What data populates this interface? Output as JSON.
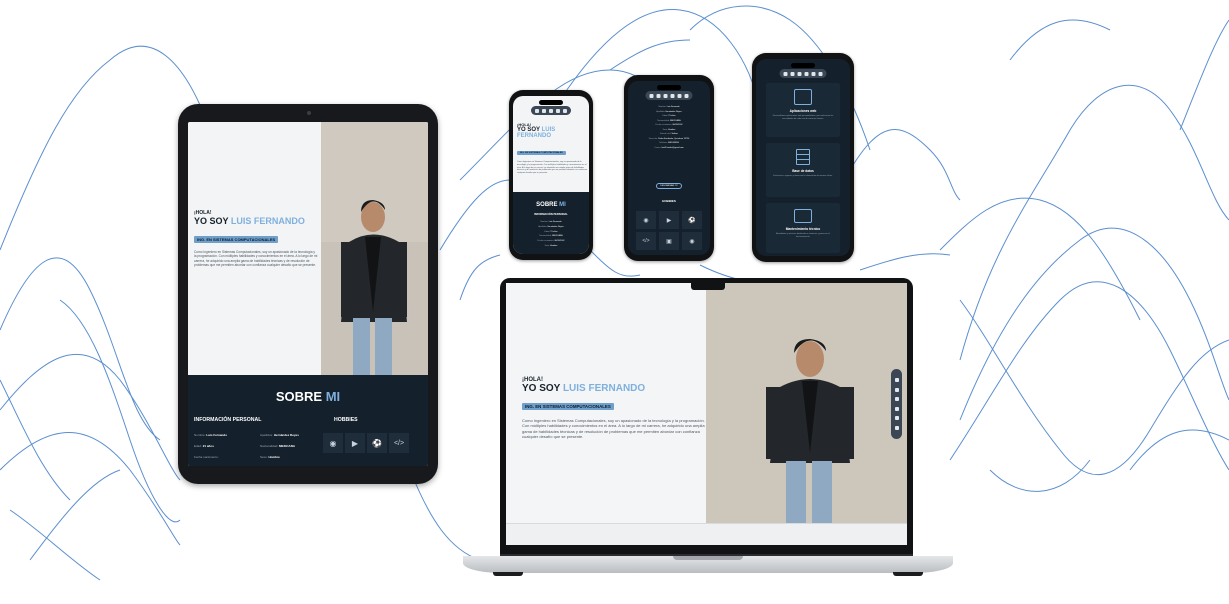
{
  "colors": {
    "navy": "#14202b",
    "accent": "#7fb0dd",
    "tag": "#6fa0cc",
    "wave": "#5b8fcf",
    "hero_bg": "#f2f4f5"
  },
  "hero": {
    "hola": "¡HOLA!",
    "yo_soy": "YO SOY",
    "name": "LUIS FERNANDO",
    "tag": "ING. EN SISTEMAS COMPUTACIONALES",
    "bio": "Como Ingeniero en Sistemas Computacionales, soy un apasionado de la tecnología y la programación. Con múltiples habilidades y conocimientos en el área. A lo largo de mi carrera, he adquirido una amplia gama de habilidades técnicas y de resolución de problemas que me permiten abordar con confianza cualquier desafío que se presente."
  },
  "about": {
    "title_a": "SOBRE",
    "title_b": "MI",
    "personal_heading": "INFORMACIÓN PERSONAL",
    "hobbies_heading": "HOBBIES",
    "fields": [
      {
        "label": "Nombre:",
        "value": "Luis Fernando"
      },
      {
        "label": "Apellidos:",
        "value": "Hernández Reyes"
      },
      {
        "label": "Edad:",
        "value": "21 años"
      },
      {
        "label": "Nacionalidad:",
        "value": "MEXICANA"
      },
      {
        "label": "Fecha nacimiento:",
        "value": ""
      },
      {
        "label": "Sexo:",
        "value": "Hombre"
      }
    ],
    "hobby_icons": [
      "headphones-icon",
      "youtube-icon",
      "soccer-ball-icon",
      "code-icon"
    ]
  },
  "phone2": {
    "fields": [
      {
        "label": "Nombre:",
        "value": "Luis Fernando"
      },
      {
        "label": "Apellidos:",
        "value": "Hernández Reyes"
      },
      {
        "label": "Edad:",
        "value": "21 años"
      },
      {
        "label": "Nacionalidad:",
        "value": "MEXICANA"
      },
      {
        "label": "Fecha nacimiento:",
        "value": "06/05/2002"
      },
      {
        "label": "Sexo:",
        "value": "Hombre"
      },
      {
        "label": "Estado civil:",
        "value": "Soltero"
      },
      {
        "label": "Dirección:",
        "value": "Pedro Escobedo, Querétaro 76726"
      },
      {
        "label": "Teléfono:",
        "value": "4481098816"
      },
      {
        "label": "Correo:",
        "value": "luis2f.hrnder@gmail.com"
      }
    ],
    "button": "DESCARGAR CV",
    "hobbies_heading": "HOBBIES"
  },
  "phone3": {
    "services": [
      {
        "title": "Aplicaciones web",
        "desc": "Desarrollamos aplicaciones web personalizadas, para solucionar las necesidades de cada uno de nuestros clientes.",
        "icon": "web-app-icon"
      },
      {
        "title": "Base de datos",
        "desc": "Estructuras, organiza y almacena la información de manera eficaz.",
        "icon": "database-icon"
      },
      {
        "title": "Mantenimiento técnico",
        "desc": "Actividades y servicios destinados a mantener y preservar el funcionamiento.",
        "icon": "maintenance-icon"
      }
    ]
  },
  "nav_icons": [
    "home-icon",
    "user-icon",
    "folder-icon",
    "tools-icon",
    "briefcase-icon",
    "contact-icon"
  ]
}
